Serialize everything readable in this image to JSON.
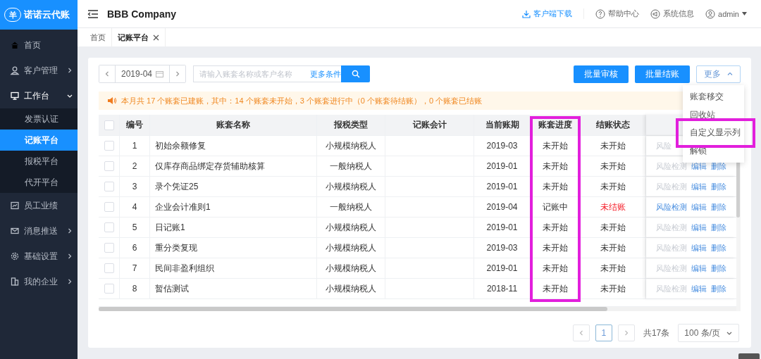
{
  "logo": {
    "mark": "羊",
    "name": "诺诺云代账"
  },
  "sidebar": {
    "items": [
      {
        "label": "首页",
        "kind": "link",
        "expanded": false
      },
      {
        "label": "客户管理",
        "kind": "group",
        "expanded": false
      },
      {
        "label": "工作台",
        "kind": "group",
        "expanded": true,
        "children": [
          {
            "label": "发票认证",
            "selected": false
          },
          {
            "label": "记账平台",
            "selected": true
          },
          {
            "label": "报税平台",
            "selected": false
          },
          {
            "label": "代开平台",
            "selected": false
          }
        ]
      },
      {
        "label": "员工业绩",
        "kind": "link",
        "expanded": false
      },
      {
        "label": "消息推送",
        "kind": "group",
        "expanded": false
      },
      {
        "label": "基础设置",
        "kind": "group",
        "expanded": false
      },
      {
        "label": "我的企业",
        "kind": "group",
        "expanded": false
      }
    ]
  },
  "header": {
    "company": "BBB Company",
    "links": [
      {
        "label": "客户端下载",
        "kind": "link"
      },
      {
        "label": "帮助中心",
        "kind": "plain"
      },
      {
        "label": "系统信息",
        "kind": "plain"
      },
      {
        "label": "admin",
        "kind": "menu"
      }
    ]
  },
  "tabs": [
    {
      "label": "首页",
      "selected": false,
      "closable": false
    },
    {
      "label": "记账平台",
      "selected": true,
      "closable": true
    }
  ],
  "toolbar": {
    "month": "2019-04",
    "search": {
      "placeholder": "请输入账套名称或客户名称"
    },
    "more_filters": "更多条件",
    "buttons": [
      "批量审核",
      "批量结账"
    ],
    "more": {
      "label": "更多",
      "expanded": true
    }
  },
  "menu": [
    {
      "label": "账套移交",
      "highlighted": false
    },
    {
      "label": "回收站",
      "highlighted": false
    },
    {
      "label": "自定义显示列",
      "highlighted": true
    },
    {
      "label": "解锁",
      "highlighted": false
    }
  ],
  "notice": "本月共 17 个账套已建账，其中：14 个账套未开始，3 个账套进行中（0 个账套待结账），0 个账套已结账",
  "table": {
    "header_checked": false,
    "columns": [
      {
        "label": "编号",
        "highlighted": false
      },
      {
        "label": "账套名称",
        "highlighted": false
      },
      {
        "label": "报税类型",
        "highlighted": false
      },
      {
        "label": "记账会计",
        "highlighted": false
      },
      {
        "label": "当前账期",
        "highlighted": false
      },
      {
        "label": "账套进度",
        "highlighted": true
      },
      {
        "label": "结账状态",
        "highlighted": false
      }
    ],
    "rows": [
      {
        "checked": false,
        "no": "1",
        "name": "初始余额修复",
        "tax_type": "小规模纳税人",
        "period": "2019-03",
        "progress": "未开始",
        "closing": {
          "text": "未开始",
          "alert": false
        },
        "actions": [
          {
            "label": "风险",
            "disabled": true
          }
        ]
      },
      {
        "checked": false,
        "no": "2",
        "name": "仅库存商品绑定存货辅助核算",
        "tax_type": "一般纳税人",
        "period": "2019-01",
        "progress": "未开始",
        "closing": {
          "text": "未开始",
          "alert": false
        },
        "actions": [
          {
            "label": "风险检测",
            "disabled": true
          },
          {
            "label": "编辑",
            "disabled": false
          },
          {
            "label": "删除",
            "disabled": false
          }
        ]
      },
      {
        "checked": false,
        "no": "3",
        "name": "录个凭证25",
        "tax_type": "小规模纳税人",
        "period": "2019-01",
        "progress": "未开始",
        "closing": {
          "text": "未开始",
          "alert": false
        },
        "actions": [
          {
            "label": "风险检测",
            "disabled": true
          },
          {
            "label": "编辑",
            "disabled": false
          },
          {
            "label": "删除",
            "disabled": false
          }
        ]
      },
      {
        "checked": false,
        "no": "4",
        "name": "企业会计准则1",
        "tax_type": "一般纳税人",
        "period": "2019-04",
        "progress": "记账中",
        "closing": {
          "text": "未结账",
          "alert": true
        },
        "actions": [
          {
            "label": "风险检测",
            "disabled": false
          },
          {
            "label": "编辑",
            "disabled": false
          },
          {
            "label": "删除",
            "disabled": false
          }
        ]
      },
      {
        "checked": false,
        "no": "5",
        "name": "日记账1",
        "tax_type": "小规模纳税人",
        "period": "2019-01",
        "progress": "未开始",
        "closing": {
          "text": "未开始",
          "alert": false
        },
        "actions": [
          {
            "label": "风险检测",
            "disabled": true
          },
          {
            "label": "编辑",
            "disabled": false
          },
          {
            "label": "删除",
            "disabled": false
          }
        ]
      },
      {
        "checked": false,
        "no": "6",
        "name": "重分类复现",
        "tax_type": "小规模纳税人",
        "period": "2019-03",
        "progress": "未开始",
        "closing": {
          "text": "未开始",
          "alert": false
        },
        "actions": [
          {
            "label": "风险检测",
            "disabled": true
          },
          {
            "label": "编辑",
            "disabled": false
          },
          {
            "label": "删除",
            "disabled": false
          }
        ]
      },
      {
        "checked": false,
        "no": "7",
        "name": "民间非盈利组织",
        "tax_type": "小规模纳税人",
        "period": "2019-01",
        "progress": "未开始",
        "closing": {
          "text": "未开始",
          "alert": false
        },
        "actions": [
          {
            "label": "风险检测",
            "disabled": true
          },
          {
            "label": "编辑",
            "disabled": false
          },
          {
            "label": "删除",
            "disabled": false
          }
        ]
      },
      {
        "checked": false,
        "no": "8",
        "name": "暂估测试",
        "tax_type": "小规模纳税人",
        "period": "2018-11",
        "progress": "未开始",
        "closing": {
          "text": "未开始",
          "alert": false
        },
        "actions": [
          {
            "label": "风险检测",
            "disabled": true
          },
          {
            "label": "编辑",
            "disabled": false
          },
          {
            "label": "删除",
            "disabled": false
          }
        ]
      }
    ]
  },
  "pagination": {
    "pages": [
      {
        "label": "1",
        "selected": true
      }
    ],
    "total": "共17条",
    "page_size": "100 条/页"
  }
}
